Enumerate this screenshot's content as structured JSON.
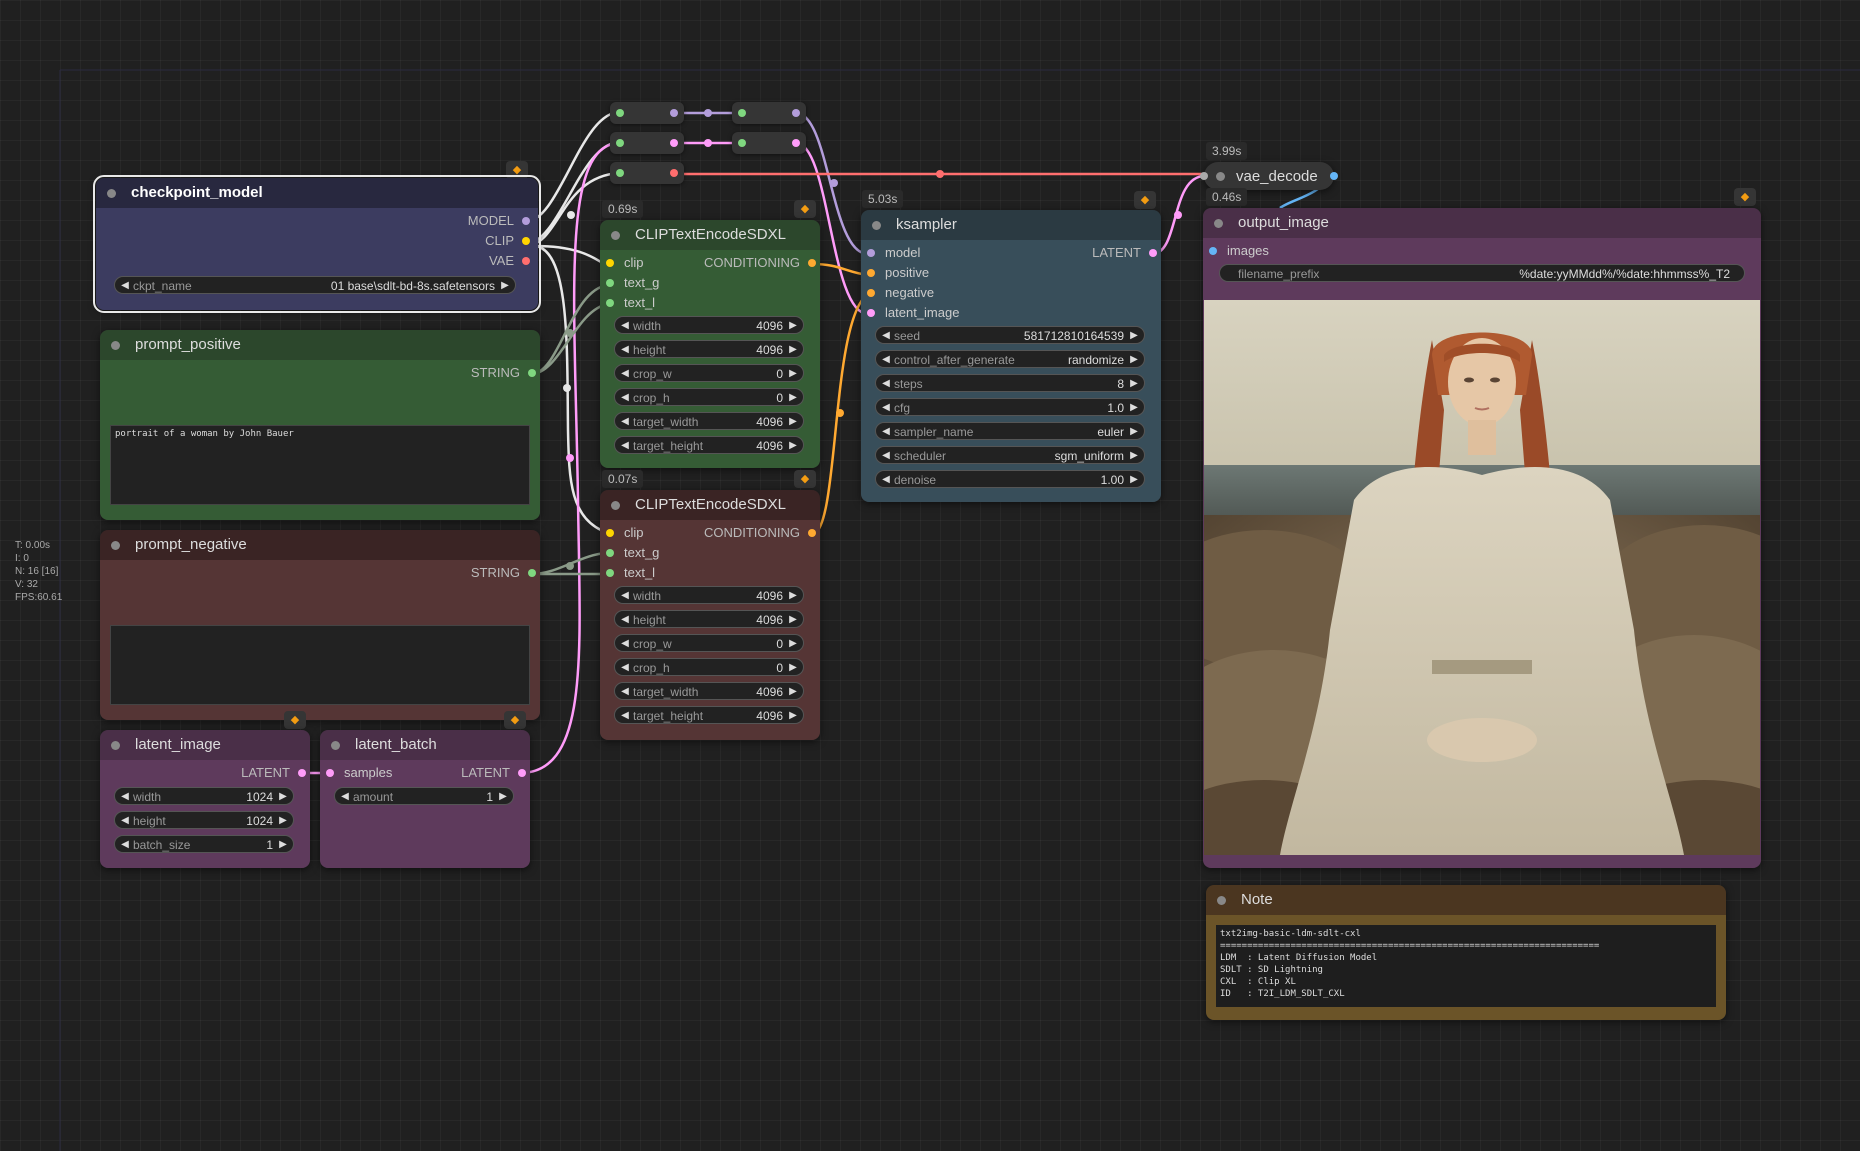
{
  "stats": {
    "lines": [
      "T: 0.00s",
      "I: 0",
      "N: 16 [16]",
      "V: 32",
      "FPS:60.61"
    ]
  },
  "reroutes": {
    "r1": {},
    "r2": {},
    "r3": {},
    "r4": {},
    "r5": {}
  },
  "checkpoint_model": {
    "title": "checkpoint_model",
    "outputs": [
      "MODEL",
      "CLIP",
      "VAE"
    ],
    "ckpt_label": "ckpt_name",
    "ckpt_value": "01 base\\sdlt-bd-8s.safetensors"
  },
  "prompt_positive": {
    "title": "prompt_positive",
    "output": "STRING",
    "text": "portrait of a woman by John Bauer"
  },
  "prompt_negative": {
    "title": "prompt_negative",
    "output": "STRING",
    "text": ""
  },
  "latent_image": {
    "title": "latent_image",
    "output": "LATENT",
    "widgets": [
      {
        "label": "width",
        "value": "1024"
      },
      {
        "label": "height",
        "value": "1024"
      },
      {
        "label": "batch_size",
        "value": "1"
      }
    ]
  },
  "latent_batch": {
    "title": "latent_batch",
    "input": "samples",
    "output": "LATENT",
    "amount_label": "amount",
    "amount_value": "1"
  },
  "clip_pos": {
    "timing": "0.69s",
    "title": "CLIPTextEncodeSDXL",
    "inputs": [
      "clip",
      "text_g",
      "text_l"
    ],
    "output": "CONDITIONING",
    "widgets": [
      {
        "label": "width",
        "value": "4096"
      },
      {
        "label": "height",
        "value": "4096"
      },
      {
        "label": "crop_w",
        "value": "0"
      },
      {
        "label": "crop_h",
        "value": "0"
      },
      {
        "label": "target_width",
        "value": "4096"
      },
      {
        "label": "target_height",
        "value": "4096"
      }
    ]
  },
  "clip_neg": {
    "timing": "0.07s",
    "title": "CLIPTextEncodeSDXL",
    "inputs": [
      "clip",
      "text_g",
      "text_l"
    ],
    "output": "CONDITIONING",
    "widgets": [
      {
        "label": "width",
        "value": "4096"
      },
      {
        "label": "height",
        "value": "4096"
      },
      {
        "label": "crop_w",
        "value": "0"
      },
      {
        "label": "crop_h",
        "value": "0"
      },
      {
        "label": "target_width",
        "value": "4096"
      },
      {
        "label": "target_height",
        "value": "4096"
      }
    ]
  },
  "ksampler": {
    "timing": "5.03s",
    "title": "ksampler",
    "inputs": [
      "model",
      "positive",
      "negative",
      "latent_image"
    ],
    "output": "LATENT",
    "widgets": [
      {
        "label": "seed",
        "value": "581712810164539"
      },
      {
        "label": "control_after_generate",
        "value": "randomize"
      },
      {
        "label": "steps",
        "value": "8"
      },
      {
        "label": "cfg",
        "value": "1.0"
      },
      {
        "label": "sampler_name",
        "value": "euler"
      },
      {
        "label": "scheduler",
        "value": "sgm_uniform"
      },
      {
        "label": "denoise",
        "value": "1.00"
      }
    ]
  },
  "vae_decode": {
    "timing": "3.99s",
    "title": "vae_decode"
  },
  "output_image": {
    "timing": "0.46s",
    "title": "output_image",
    "input": "images",
    "prefix_label": "filename_prefix",
    "prefix_value": "%date:yyMMdd%/%date:hhmmss%_T2"
  },
  "note": {
    "title": "Note",
    "text": "txt2img-basic-ldm-sdlt-cxl\n======================================================================\nLDM  : Latent Diffusion Model\nSDLT : SD Lightning\nCXL  : Clip XL\nID   : T2I_LDM_SDLT_CXL"
  },
  "icons": {
    "badge": "fox-badge-icon"
  },
  "colors": {
    "checkpoint": "#353554",
    "positive": "#2e4a2e",
    "negative": "#4a2c2c",
    "latent": "#5a3558",
    "clip_pos": "#355c35",
    "clip_neg": "#5a2e2e",
    "ksampler": "#334651",
    "output": "#5a3558",
    "note": "#5a4520",
    "wire_model": "#b39ddb",
    "wire_clip": "#ffd500",
    "wire_vae": "#ff6e6e",
    "wire_latent": "#ff9cf9",
    "wire_cond": "#ffa931",
    "wire_string": "#8a9a88",
    "wire_image": "#64b5f6"
  }
}
